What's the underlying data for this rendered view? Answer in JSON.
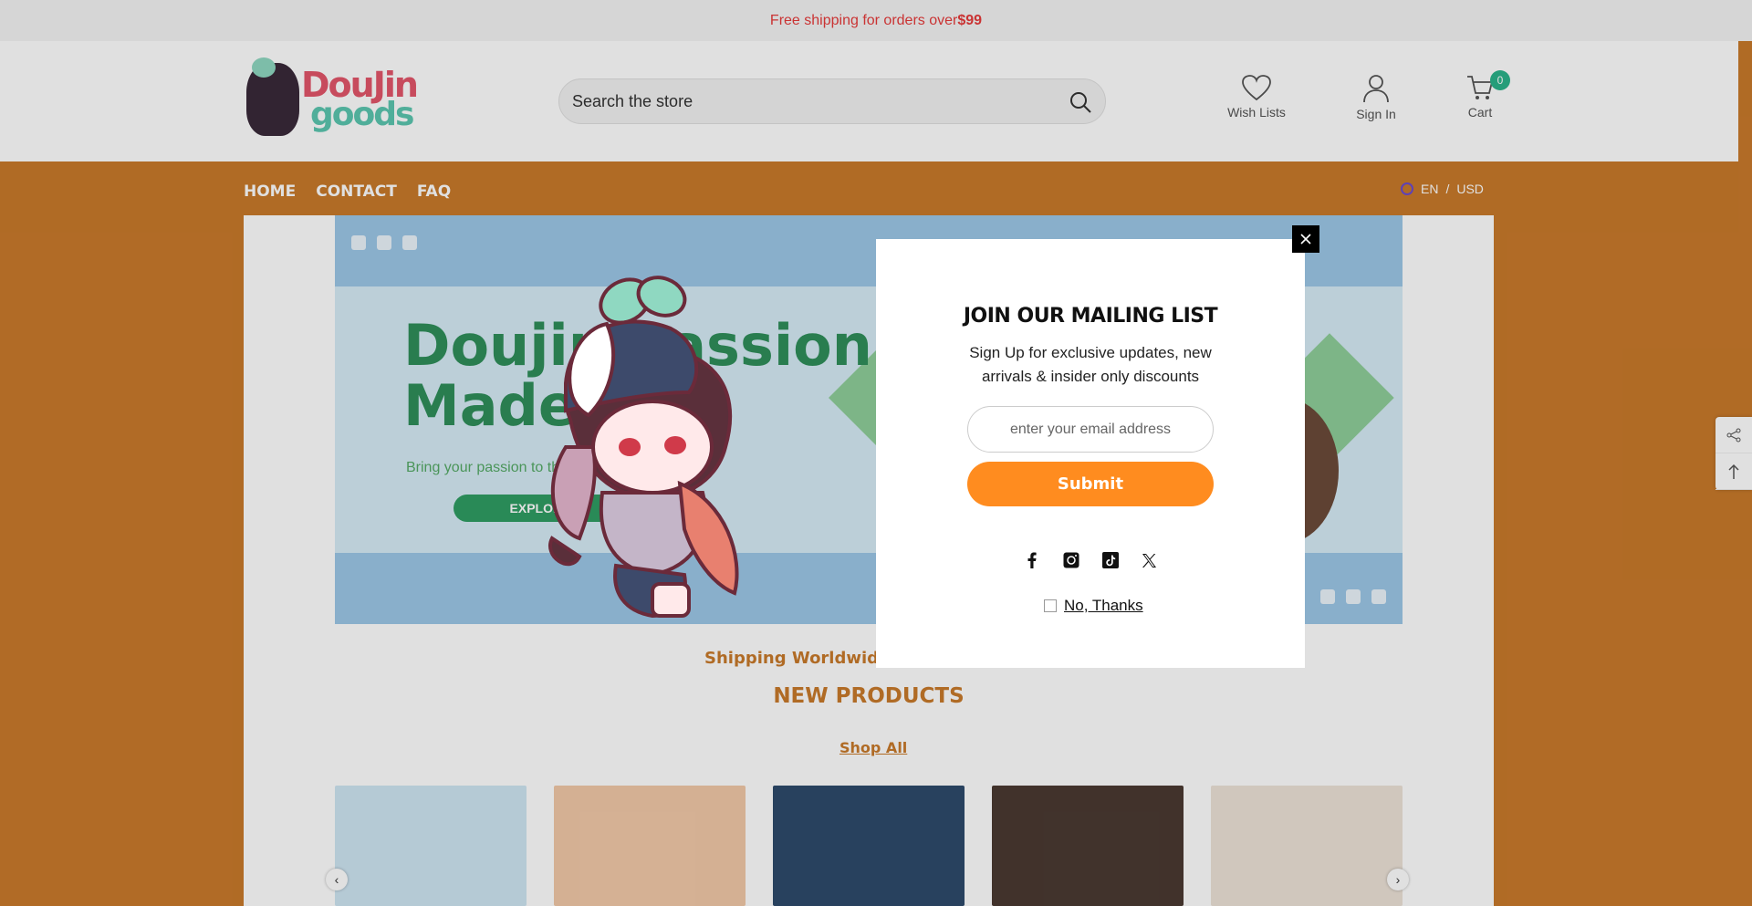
{
  "announcement": {
    "prefix": "Free shipping for orders over ",
    "amount": "$99"
  },
  "header": {
    "logo_text_1": "DouJin",
    "logo_text_2": "goods",
    "search_placeholder": "Search the store",
    "wishlist_label": "Wish Lists",
    "signin_label": "Sign In",
    "cart_label": "Cart",
    "cart_count": "0"
  },
  "nav": {
    "items": [
      "HOME",
      "CONTACT",
      "FAQ"
    ],
    "lang": "EN",
    "currency": "USD",
    "separator": "/"
  },
  "hero": {
    "title": "Doujin Passion Made",
    "subtitle": "Bring your passion to the world",
    "cta": "EXPLORE"
  },
  "shipping_text": "Shipping Worldwide. N",
  "new_products": {
    "title": "NEW PRODUCTS",
    "shop_all": "Shop All"
  },
  "popup": {
    "close_icon": "close-icon",
    "title": "JOIN OUR MAILING LIST",
    "description": "Sign Up for exclusive updates, new arrivals & insider only discounts",
    "email_placeholder": "enter your email address",
    "submit_label": "Submit",
    "socials": [
      "facebook-icon",
      "instagram-icon",
      "tiktok-icon",
      "x-icon"
    ],
    "no_thanks": "No, Thanks"
  },
  "colors": {
    "accent_orange": "#ff8c1f",
    "page_orange": "#c97a2b",
    "announce_red": "#e63b3b",
    "badge_green": "#2bb38a"
  }
}
